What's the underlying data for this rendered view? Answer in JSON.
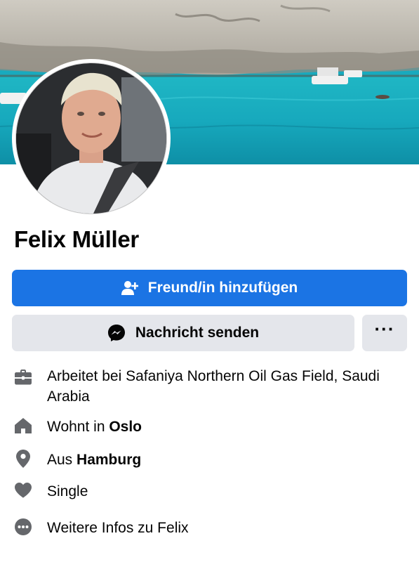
{
  "profile": {
    "name": "Felix Müller"
  },
  "actions": {
    "add_friend_label": "Freund/in hinzufügen",
    "message_label": "Nachricht senden",
    "more_label": "···"
  },
  "info": {
    "work": "Arbeitet bei Safaniya Northern Oil Gas Field, Saudi Arabia",
    "lives_prefix": "Wohnt in ",
    "lives_city": "Oslo",
    "from_prefix": "Aus ",
    "from_city": "Hamburg",
    "relationship": "Single",
    "more_info": "Weitere Infos zu Felix"
  },
  "colors": {
    "primary": "#1b74e4",
    "secondary_button": "#e4e6eb",
    "icon_gray": "#65676b",
    "text": "#050505"
  },
  "icons": {
    "add_friend": "person-plus-icon",
    "message": "messenger-icon",
    "work": "briefcase-icon",
    "lives": "home-icon",
    "from": "location-pin-icon",
    "relationship": "heart-icon",
    "more_info": "more-dots-icon"
  }
}
